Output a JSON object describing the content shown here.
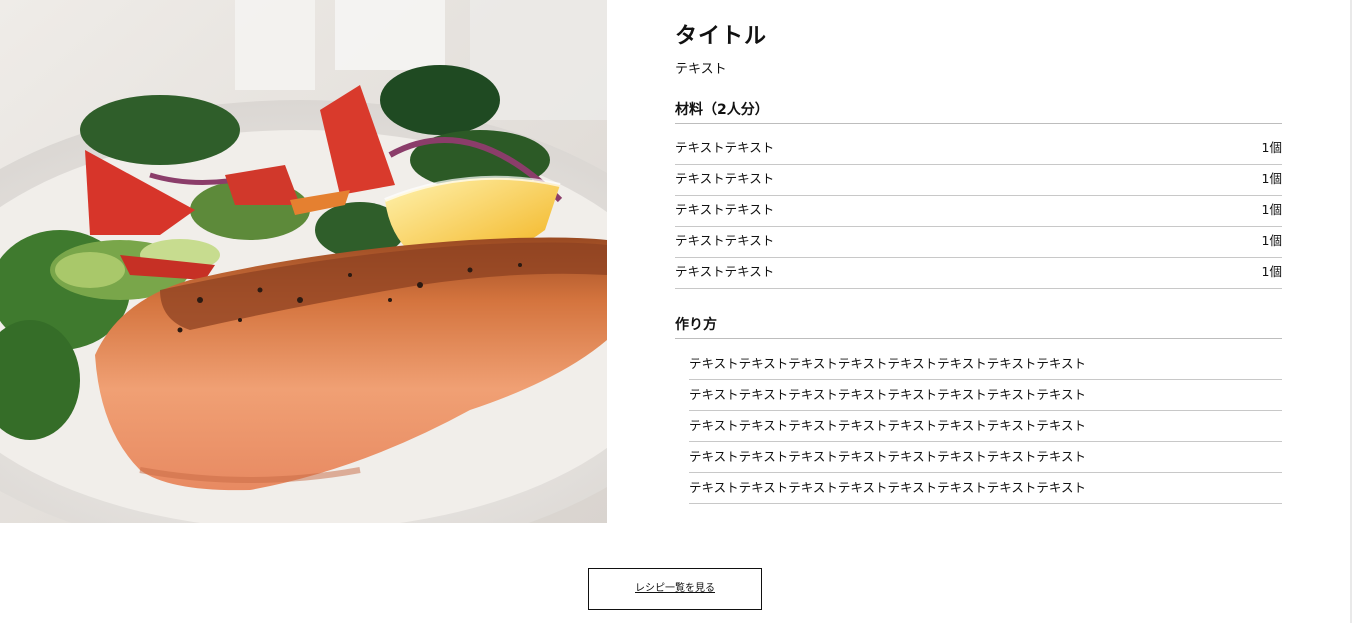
{
  "photo": {
    "description_name": "grilled-salmon-salad-photo"
  },
  "recipe": {
    "title": "タイトル",
    "description": "テキスト",
    "ingredients_heading": "材料（2人分）",
    "ingredients": [
      {
        "name": "テキストテキスト",
        "amount": "1個"
      },
      {
        "name": "テキストテキスト",
        "amount": "1個"
      },
      {
        "name": "テキストテキスト",
        "amount": "1個"
      },
      {
        "name": "テキストテキスト",
        "amount": "1個"
      },
      {
        "name": "テキストテキスト",
        "amount": "1個"
      }
    ],
    "steps_heading": "作り方",
    "steps": [
      "テキストテキストテキストテキストテキストテキストテキストテキスト",
      "テキストテキストテキストテキストテキストテキストテキストテキスト",
      "テキストテキストテキストテキストテキストテキストテキストテキスト",
      "テキストテキストテキストテキストテキストテキストテキストテキスト",
      "テキストテキストテキストテキストテキストテキストテキストテキスト"
    ]
  },
  "footer": {
    "list_button_label": "レシピ一覧を見る"
  }
}
